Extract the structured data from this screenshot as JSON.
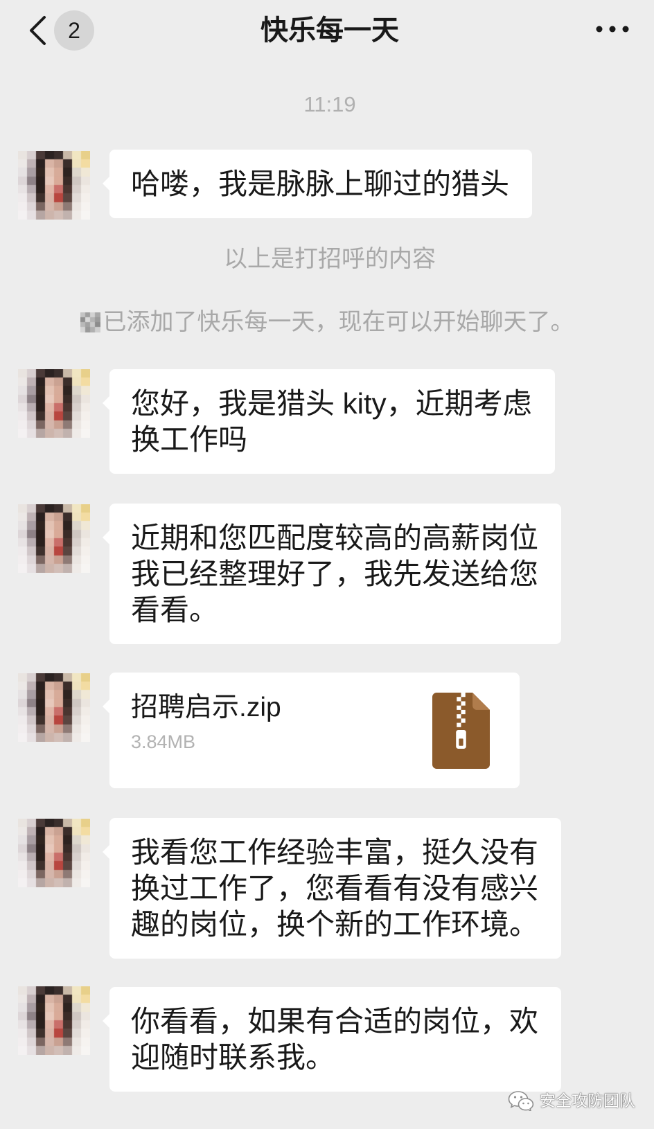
{
  "header": {
    "back_icon": "chevron-left-icon",
    "unread_count": "2",
    "title": "快乐每一天",
    "more_icon": "more-dots-icon"
  },
  "timestamp": "11:19",
  "messages": [
    {
      "type": "text",
      "lines": [
        "哈喽，我是脉脉上聊过的猎头"
      ]
    },
    {
      "type": "text",
      "lines": [
        "您好，我是猎头 kity，近期考虑",
        "换工作吗"
      ]
    },
    {
      "type": "text",
      "lines": [
        "近期和您匹配度较高的高薪岗位",
        "我已经整理好了，我先发送给您",
        "看看。"
      ]
    },
    {
      "type": "file",
      "file_name": "招聘启示.zip",
      "file_size": "3.84MB",
      "file_icon": "zip-file-icon"
    },
    {
      "type": "text",
      "lines": [
        "我看您工作经验丰富，挺久没有",
        "换过工作了，您看看有没有感兴",
        "趣的岗位，换个新的工作环境。"
      ]
    },
    {
      "type": "text",
      "lines": [
        "你看看，如果有合适的岗位，欢",
        "迎随时联系我。"
      ]
    }
  ],
  "system_notes": [
    {
      "text": "以上是打招呼的内容"
    },
    {
      "icon": "masked-name-icon",
      "text": "已添加了快乐每一天，现在可以开始聊天了。"
    }
  ],
  "watermark": {
    "icon": "wechat-icon",
    "text": "安全攻防团队"
  },
  "colors": {
    "background": "#ededed",
    "bubble": "#ffffff",
    "text": "#191919",
    "system_text": "#a8a8a8",
    "zip_icon": "#8b5a2b",
    "badge": "#d6d6d6"
  }
}
